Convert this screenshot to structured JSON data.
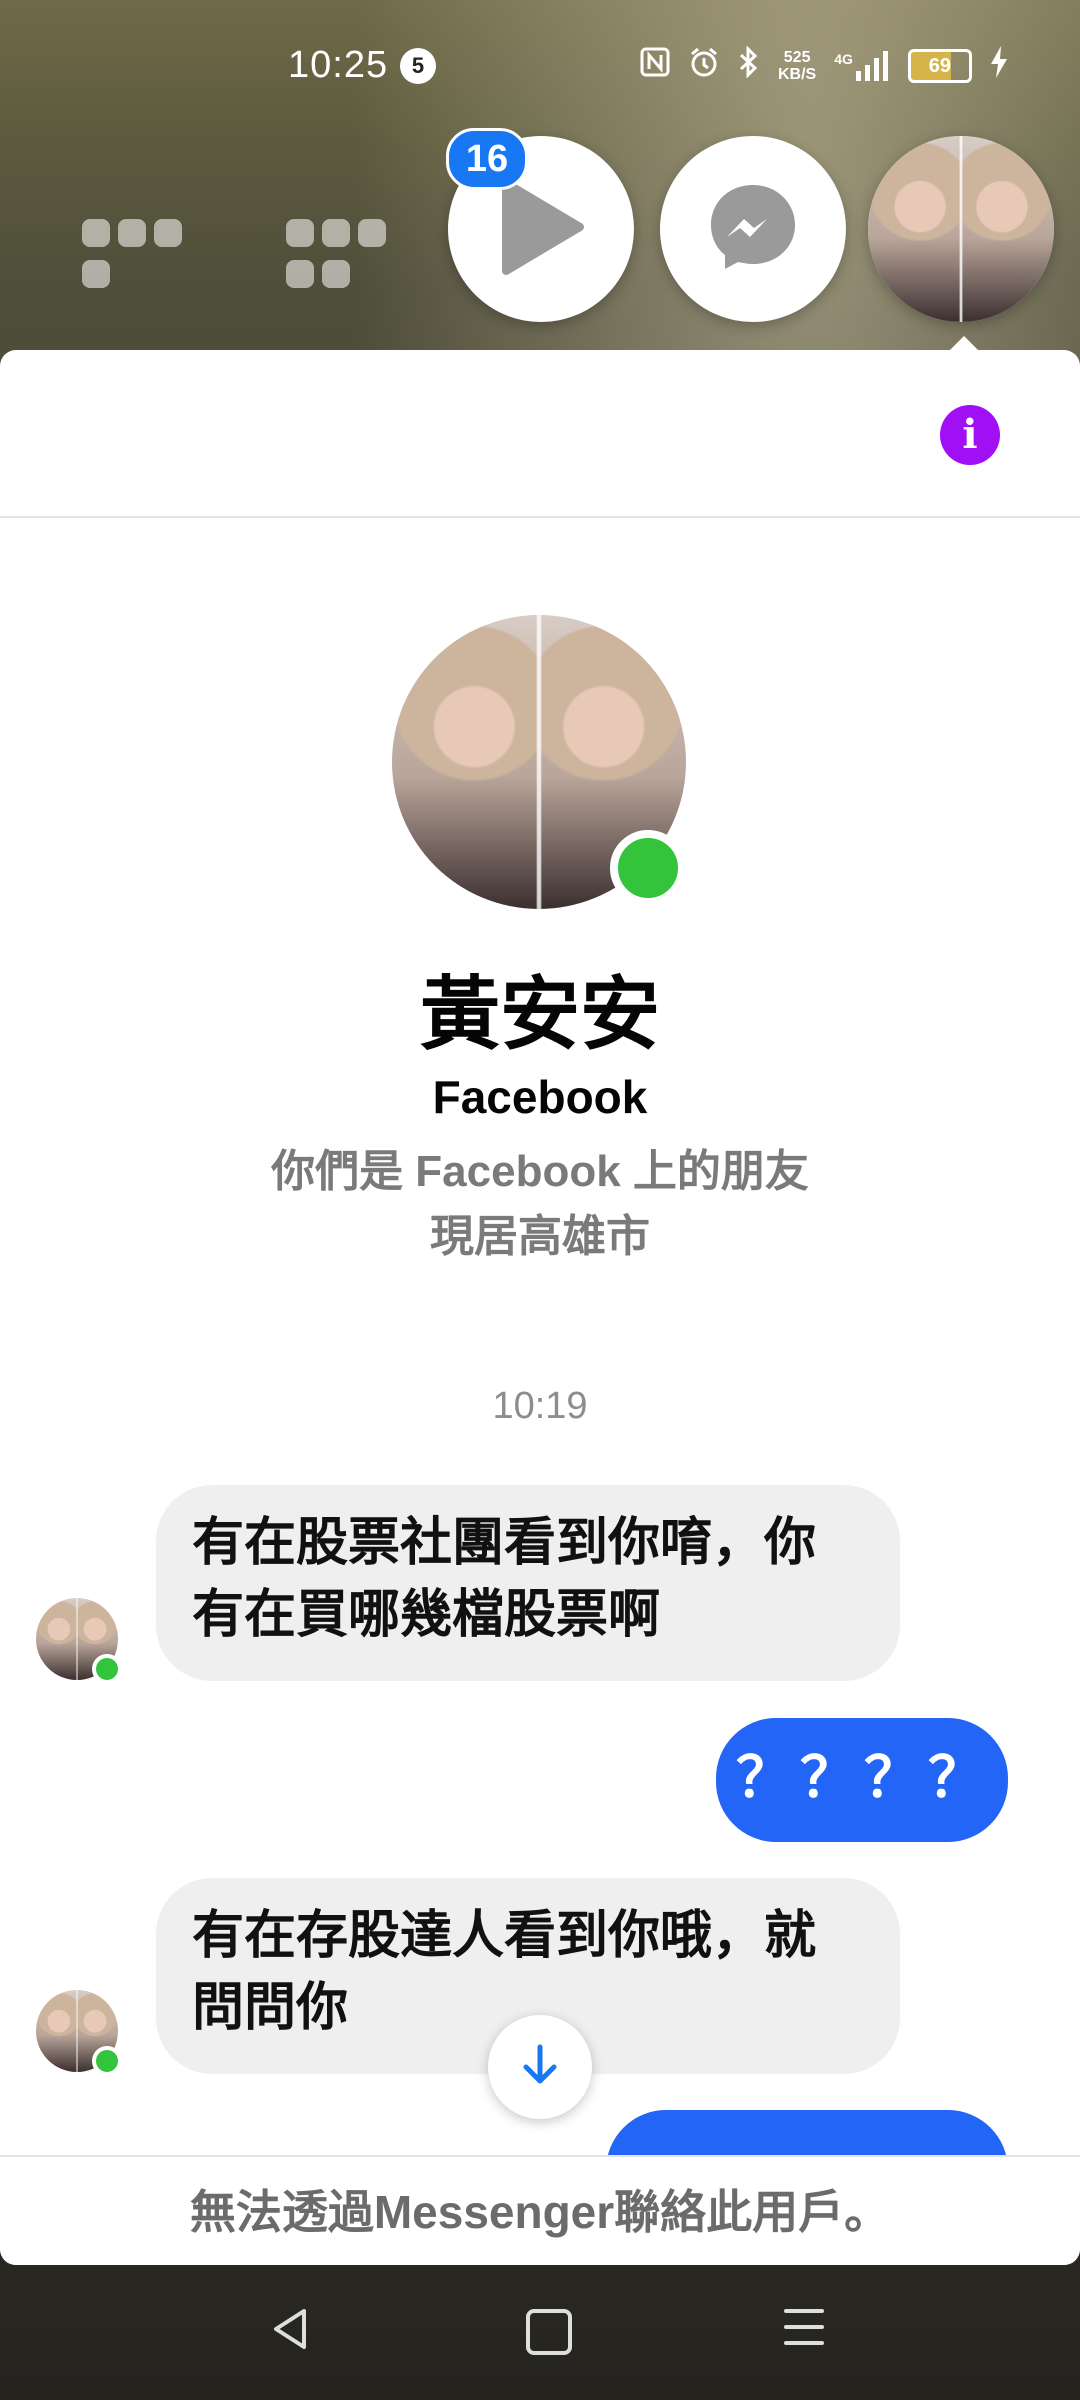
{
  "status_bar": {
    "time": "10:25",
    "notification_count": "5",
    "speed_value": "525",
    "speed_unit": "KB/S",
    "network": "4G",
    "battery": "69"
  },
  "chat_heads": {
    "badge": "16",
    "items": [
      "play-app",
      "messenger",
      "contact-avatar"
    ]
  },
  "header": {
    "info_icon": "i"
  },
  "profile": {
    "name": "黃安安",
    "platform": "Facebook",
    "relation": "你們是 Facebook 上的朋友",
    "location": "現居高雄市"
  },
  "conversation": {
    "timestamp": "10:19",
    "messages": [
      {
        "direction": "incoming",
        "text": "有在股票社團看到你唷，你有在買哪幾檔股票啊"
      },
      {
        "direction": "outgoing",
        "text": "？？？？"
      },
      {
        "direction": "incoming",
        "text": "有在存股達人看到你哦，就問問你"
      },
      {
        "direction": "outgoing",
        "text": ""
      }
    ]
  },
  "footer": {
    "notice": "無法透過Messenger聯絡此用戶。"
  },
  "colors": {
    "outgoing_bubble": "#2365f6",
    "incoming_bubble": "#efefef",
    "info_button": "#a10ff5",
    "online": "#34c43c",
    "badge": "#1877f2"
  }
}
